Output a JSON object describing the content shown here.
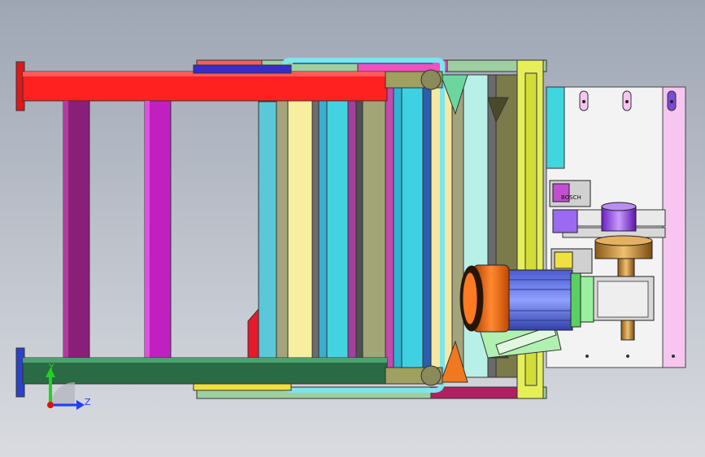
{
  "viewport": {
    "background_top": "#9ea6b4",
    "background_bottom": "#d6d8dd"
  },
  "triad": {
    "y_label": "Y",
    "z_label": "Z",
    "y_color": "#1fd21f",
    "z_color": "#1f3cff",
    "origin_color": "#e01010"
  },
  "model": {
    "motor_label": "BOSCH"
  }
}
